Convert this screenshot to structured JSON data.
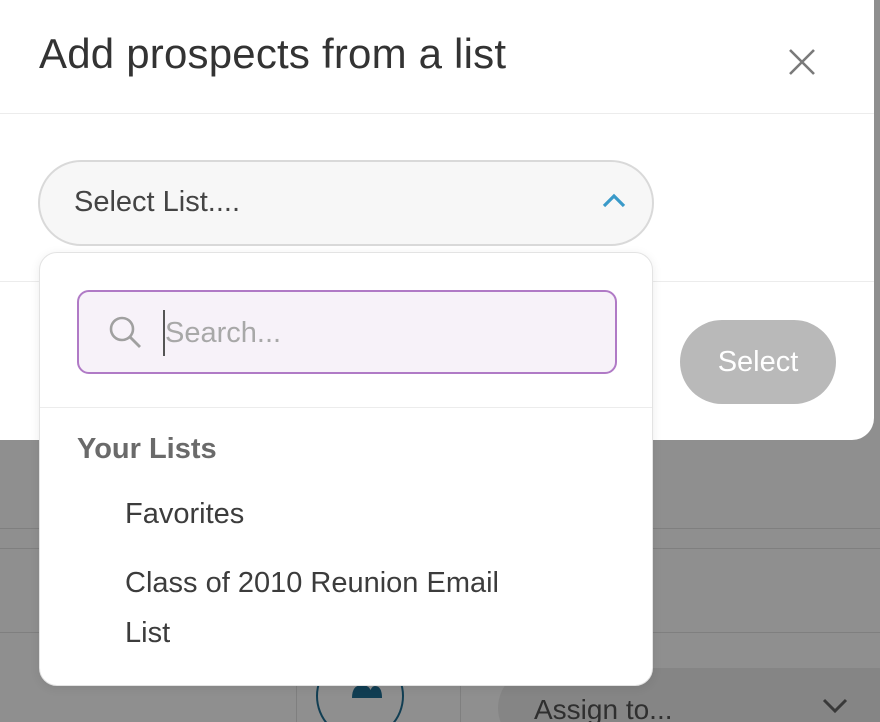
{
  "modal": {
    "title": "Add prospects from a list",
    "select_list_placeholder": "Select List....",
    "select_button_label": "Select"
  },
  "dropdown": {
    "search_placeholder": "Search...",
    "group_heading": "Your Lists",
    "items": [
      {
        "label": "Favorites"
      },
      {
        "label": "Class of 2010 Reunion Email List"
      }
    ]
  },
  "background": {
    "assign_placeholder": "Assign to..."
  },
  "icons": {
    "close": "close-icon",
    "chevron_up": "chevron-up-icon",
    "search": "search-icon",
    "add_people": "add-people-icon",
    "chevron_down": "chevron-down-icon"
  },
  "colors": {
    "accent_chevron": "#3a9ac9",
    "search_border": "#b07ac6",
    "select_button_bg": "#b9b9b9",
    "add_button_border": "#1f6f94"
  }
}
